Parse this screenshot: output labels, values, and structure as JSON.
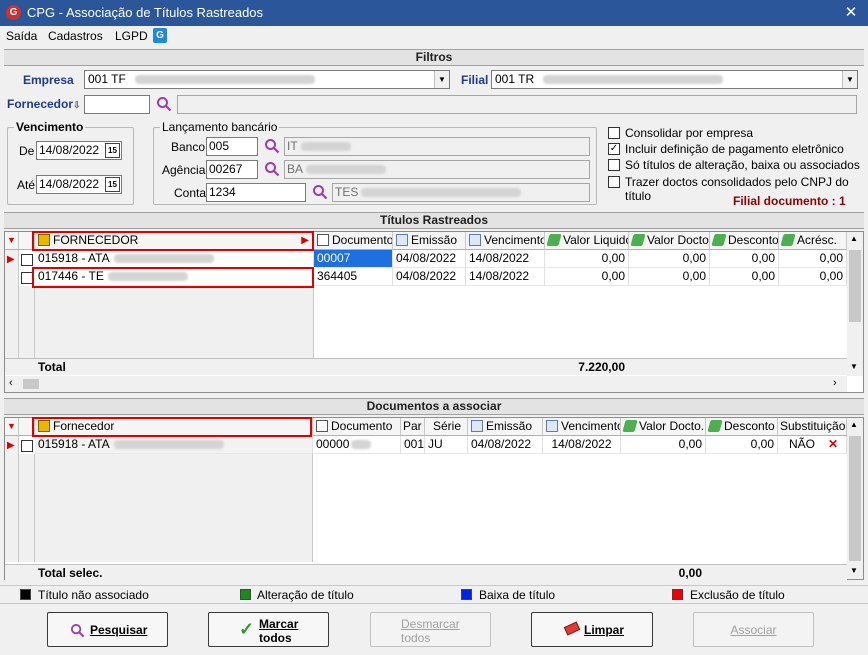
{
  "window": {
    "title": "CPG - Associação de Títulos Rastreados",
    "logo_letter": "G",
    "close": "✕"
  },
  "menu": {
    "items": [
      "Saída",
      "Cadastros",
      "LGPD"
    ],
    "g_icon": "G"
  },
  "filtros": {
    "title": "Filtros",
    "empresa_label": "Empresa",
    "empresa_value": "001 TF",
    "filial_label": "Filial",
    "filial_value": "001 TR",
    "fornecedor_label": "Fornecedor",
    "fornecedor_value": "",
    "vencimento_label": "Vencimento",
    "de_label": "De",
    "de_value": "14/08/2022",
    "ate_label": "Até",
    "ate_value": "14/08/2022",
    "cal_icon": "15",
    "lancamento_label": "Lançamento bancário",
    "banco_label": "Banco",
    "banco_value": "005",
    "banco_desc": "IT",
    "agencia_label": "Agência",
    "agencia_value": "00267",
    "agencia_desc": "BA",
    "conta_label": "Conta",
    "conta_value": "1234",
    "conta_desc": "TES",
    "options": [
      {
        "label": "Consolidar por empresa",
        "checked": false
      },
      {
        "label": "Incluir definição de pagamento eletrônico",
        "checked": true
      },
      {
        "label": "Só títulos de alteração, baixa ou associados",
        "checked": false
      },
      {
        "label": "Trazer doctos consolidados pelo CNPJ do título",
        "checked": false
      }
    ],
    "filial_documento": "Filial documento : 1"
  },
  "titulos": {
    "title": "Títulos Rastreados",
    "columns": [
      "FORNECEDOR",
      "Documento",
      "Emissão",
      "Vencimento",
      "Valor Liquido",
      "Valor Docto.",
      "Desconto",
      "Acrésc."
    ],
    "rows": [
      {
        "fornecedor": "015918 - ATA",
        "documento": "00007",
        "emissao": "04/08/2022",
        "vencimento": "14/08/2022",
        "valor_liquido": "0,00",
        "valor_docto": "0,00",
        "desconto": "0,00",
        "acresc": "0,00"
      },
      {
        "fornecedor": "017446 - TE",
        "documento": "364405",
        "emissao": "04/08/2022",
        "vencimento": "14/08/2022",
        "valor_liquido": "0,00",
        "valor_docto": "0,00",
        "desconto": "0,00",
        "acresc": "0,00"
      }
    ],
    "total_label": "Total",
    "total_value": "7.220,00"
  },
  "documentos": {
    "title": "Documentos a associar",
    "columns": [
      "Fornecedor",
      "Documento",
      "Par",
      "Série",
      "Emissão",
      "Vencimento",
      "Valor Docto.",
      "Desconto",
      "Substituição"
    ],
    "rows": [
      {
        "fornecedor": "015918 - ATA",
        "documento": "00000",
        "par": "001",
        "serie": "JU",
        "emissao": "04/08/2022",
        "vencimento": "14/08/2022",
        "valor_docto": "0,00",
        "desconto": "0,00",
        "substituicao": "NÃO"
      }
    ],
    "total_label": "Total selec.",
    "total_value": "0,00"
  },
  "legend": [
    {
      "label": "Título não associado",
      "color": "#000000"
    },
    {
      "label": "Alteração de título",
      "color": "#1a8a1a"
    },
    {
      "label": "Baixa de título",
      "color": "#0022ee"
    },
    {
      "label": "Exclusão de título",
      "color": "#ee0000"
    }
  ],
  "buttons": {
    "pesquisar": "Pesquisar",
    "marcar_1": "Marcar",
    "marcar_2": "todos",
    "desmarcar_1": "Desmarcar",
    "desmarcar_2": "todos",
    "limpar": "Limpar",
    "associar": "Associar"
  }
}
